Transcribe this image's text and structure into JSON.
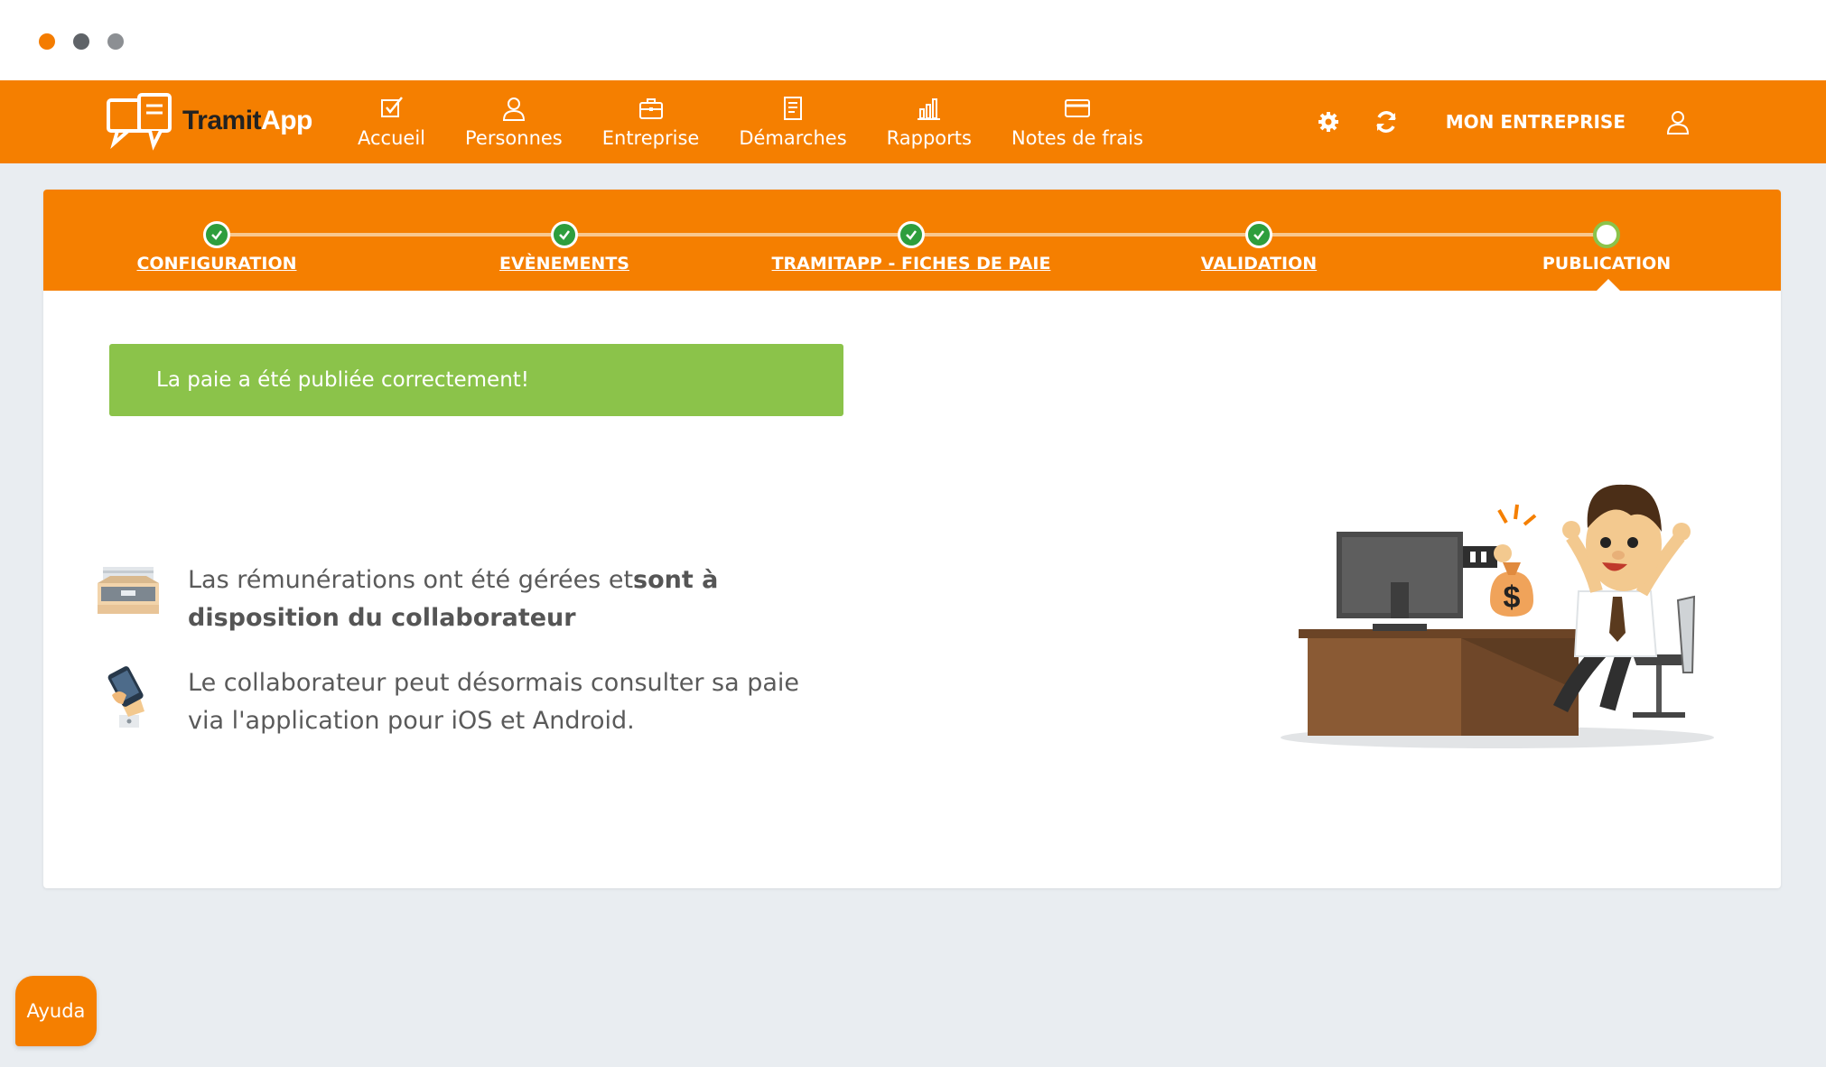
{
  "window": {
    "controls": [
      "close",
      "minimize",
      "maximize"
    ]
  },
  "app": {
    "logo": {
      "part1": "Tramit",
      "part2": "App"
    }
  },
  "nav": {
    "items": [
      {
        "label": "Accueil",
        "icon": "checkbox-icon"
      },
      {
        "label": "Personnes",
        "icon": "person-icon"
      },
      {
        "label": "Entreprise",
        "icon": "briefcase-icon"
      },
      {
        "label": "Démarches",
        "icon": "document-icon"
      },
      {
        "label": "Rapports",
        "icon": "bar-chart-icon"
      },
      {
        "label": "Notes de frais",
        "icon": "credit-card-icon"
      }
    ],
    "right": {
      "settings_icon": "gear-icon",
      "refresh_icon": "refresh-icon",
      "company_label": "MON ENTREPRISE",
      "user_icon": "user-icon"
    }
  },
  "stepper": {
    "steps": [
      {
        "label": "CONFIGURATION",
        "status": "done"
      },
      {
        "label": "EVÈNEMENTS",
        "status": "done"
      },
      {
        "label": "TRAMITAPP - FICHES DE PAIE",
        "status": "done"
      },
      {
        "label": "VALIDATION",
        "status": "done"
      },
      {
        "label": "PUBLICATION",
        "status": "current"
      }
    ]
  },
  "content": {
    "success_message": "La paie a été publiée correctement!",
    "info1": {
      "text_normal": "Las rémunérations ont été gérées et",
      "text_bold": "sont à disposition du collaborateur",
      "icon": "inbox-tray-icon"
    },
    "info2": {
      "text": "Le collaborateur peut désormais consulter sa paie via l'application pour iOS et Android.",
      "icon": "phone-hand-icon"
    }
  },
  "help": {
    "label": "Ayuda"
  },
  "colors": {
    "brand_orange": "#f57f00",
    "success_green": "#8bc34a",
    "step_done": "#2e9e3d",
    "background": "#e9edf1"
  }
}
